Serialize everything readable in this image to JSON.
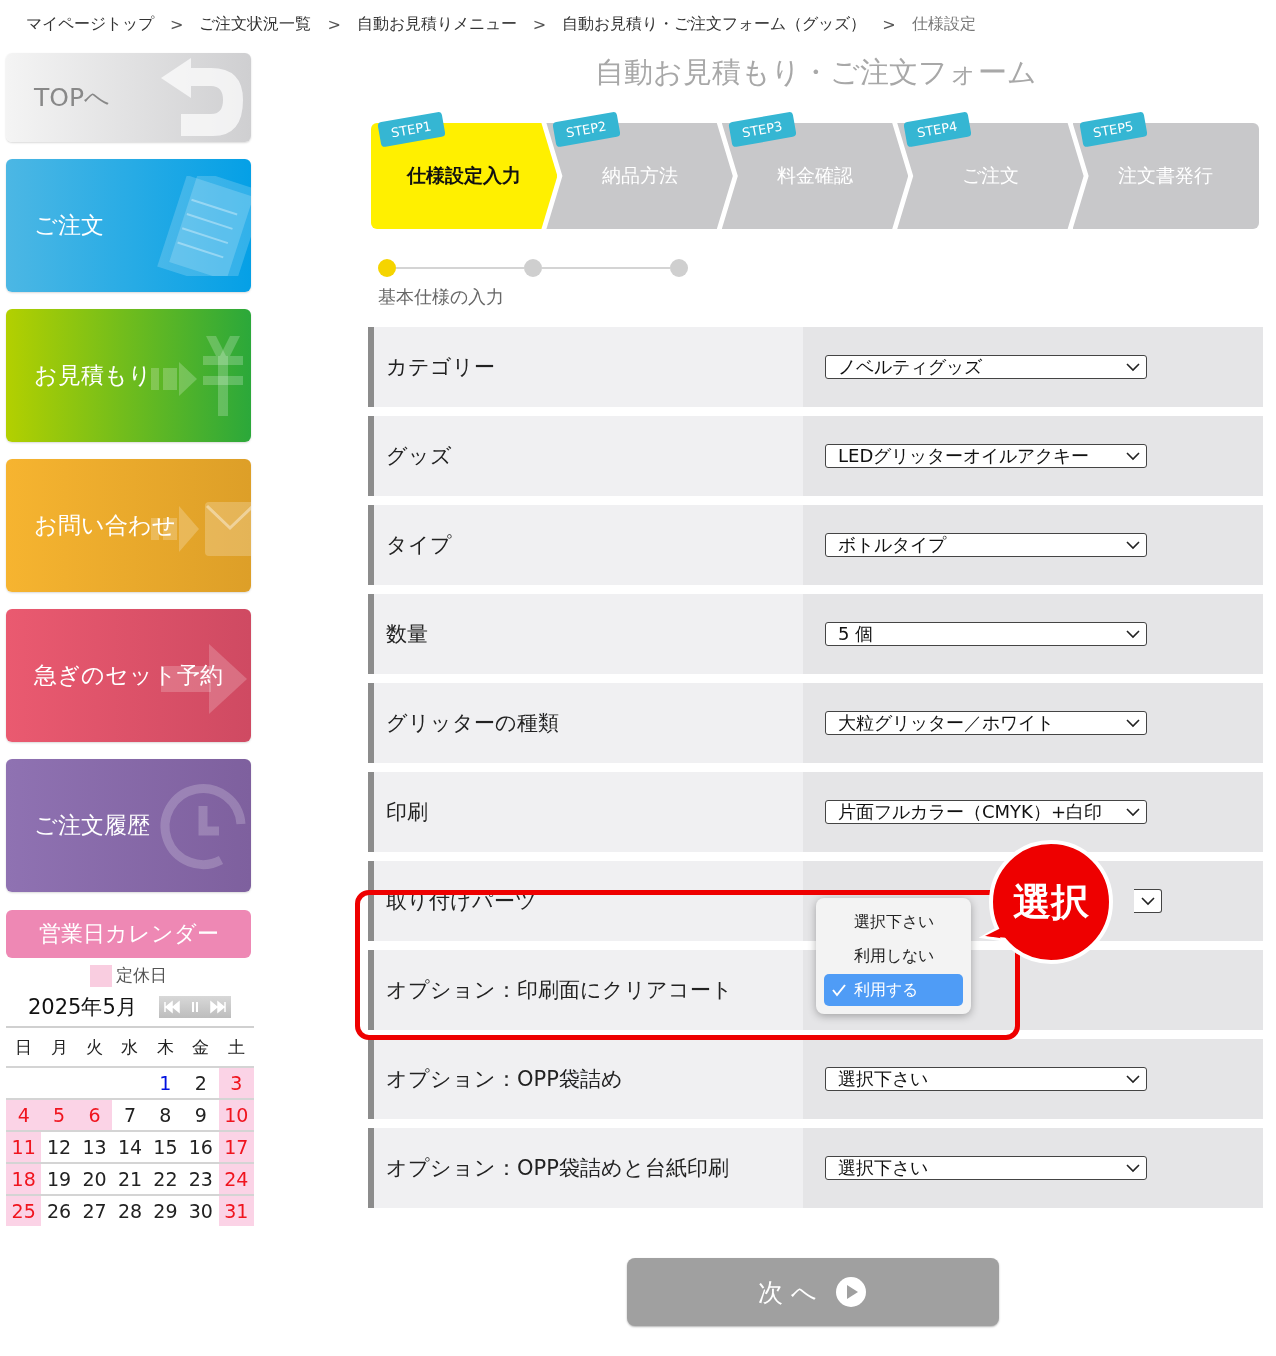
{
  "breadcrumb": {
    "separator": ">",
    "items": [
      {
        "label": "マイページトップ",
        "current": false
      },
      {
        "label": "ご注文状況一覧",
        "current": false
      },
      {
        "label": "自動お見積りメニュー",
        "current": false
      },
      {
        "label": "自動お見積り・ご注文フォーム（グッズ）",
        "current": false
      },
      {
        "label": "仕様設定",
        "current": true
      }
    ]
  },
  "sidebar": {
    "items": [
      {
        "label": "TOPへ",
        "kind": "top"
      },
      {
        "label": "ご注文",
        "kind": "order"
      },
      {
        "label": "お見積もり",
        "kind": "estimate"
      },
      {
        "label": "お問い合わせ",
        "kind": "contact"
      },
      {
        "label": "急ぎのセット予約",
        "kind": "reserve"
      },
      {
        "label": "ご注文履歴",
        "kind": "history"
      }
    ]
  },
  "calendar": {
    "title": "営業日カレンダー",
    "legend": "定休日",
    "month": "2025年5月",
    "weekdays": [
      "日",
      "月",
      "火",
      "水",
      "木",
      "金",
      "土"
    ],
    "weeks": [
      [
        {
          "day": "1",
          "holiday": false,
          "today": true
        },
        {
          "day": "2",
          "holiday": false,
          "today": false
        },
        {
          "day": "3",
          "holiday": true,
          "today": false
        }
      ],
      [
        {
          "day": "4",
          "holiday": true,
          "today": false
        },
        {
          "day": "5",
          "holiday": true,
          "today": false
        },
        {
          "day": "6",
          "holiday": true,
          "today": false
        },
        {
          "day": "7",
          "holiday": false,
          "today": false
        },
        {
          "day": "8",
          "holiday": false,
          "today": false
        },
        {
          "day": "9",
          "holiday": false,
          "today": false
        },
        {
          "day": "10",
          "holiday": true,
          "today": false
        }
      ],
      [
        {
          "day": "11",
          "holiday": true,
          "today": false
        },
        {
          "day": "12",
          "holiday": false,
          "today": false
        },
        {
          "day": "13",
          "holiday": false,
          "today": false
        },
        {
          "day": "14",
          "holiday": false,
          "today": false
        },
        {
          "day": "15",
          "holiday": false,
          "today": false
        },
        {
          "day": "16",
          "holiday": false,
          "today": false
        },
        {
          "day": "17",
          "holiday": true,
          "today": false
        }
      ],
      [
        {
          "day": "18",
          "holiday": true,
          "today": false
        },
        {
          "day": "19",
          "holiday": false,
          "today": false
        },
        {
          "day": "20",
          "holiday": false,
          "today": false
        },
        {
          "day": "21",
          "holiday": false,
          "today": false
        },
        {
          "day": "22",
          "holiday": false,
          "today": false
        },
        {
          "day": "23",
          "holiday": false,
          "today": false
        },
        {
          "day": "24",
          "holiday": true,
          "today": false
        }
      ],
      [
        {
          "day": "25",
          "holiday": true,
          "today": false
        },
        {
          "day": "26",
          "holiday": false,
          "today": false
        },
        {
          "day": "27",
          "holiday": false,
          "today": false
        },
        {
          "day": "28",
          "holiday": false,
          "today": false
        },
        {
          "day": "29",
          "holiday": false,
          "today": false
        },
        {
          "day": "30",
          "holiday": false,
          "today": false
        },
        {
          "day": "31",
          "holiday": true,
          "today": false
        }
      ]
    ]
  },
  "title": "自動お見積もり・ご注文フォーム",
  "steps": [
    {
      "badge": "STEP1",
      "label": "仕様設定入力",
      "selected": true
    },
    {
      "badge": "STEP2",
      "label": "納品方法",
      "selected": false
    },
    {
      "badge": "STEP3",
      "label": "料金確認",
      "selected": false
    },
    {
      "badge": "STEP4",
      "label": "ご注文",
      "selected": false
    },
    {
      "badge": "STEP5",
      "label": "注文書発行",
      "selected": false
    }
  ],
  "progress": {
    "label": "基本仕様の入力",
    "dots": [
      {
        "active": true
      },
      {
        "active": false
      },
      {
        "active": false
      }
    ]
  },
  "rows": [
    {
      "label": "カテゴリー",
      "value": "ノベルティグッズ"
    },
    {
      "label": "グッズ",
      "value": "LEDグリッターオイルアクキー"
    },
    {
      "label": "タイプ",
      "value": "ボトルタイプ"
    },
    {
      "label": "数量",
      "value": "5 個"
    },
    {
      "label": "グリッターの種類",
      "value": "大粒グリッター／ホワイト"
    },
    {
      "label": "印刷",
      "value": "片面フルカラー（CMYK）+白印"
    },
    {
      "label": "取り付けパーツ",
      "covered_select": true
    },
    {
      "label": "オプション：印刷面にクリアコート",
      "dropdown": {
        "options": [
          {
            "label": "選択下さい",
            "selected": false
          },
          {
            "label": "利用しない",
            "selected": false
          },
          {
            "label": "利用する",
            "selected": true
          }
        ]
      }
    },
    {
      "label": "オプション：OPP袋詰め",
      "value": "選択下さい"
    },
    {
      "label": "オプション：OPP袋詰めと台紙印刷",
      "value": "選択下さい"
    }
  ],
  "annotation": {
    "label": "選択"
  },
  "next_button": {
    "label": "次 へ"
  }
}
